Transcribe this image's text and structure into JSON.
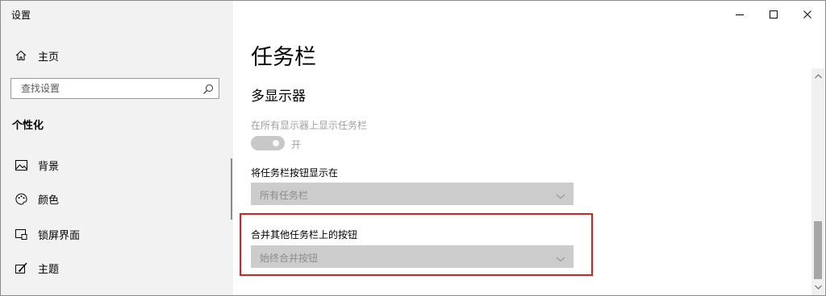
{
  "window": {
    "title": "设置",
    "minimize_glyph": "–",
    "maximize_glyph": "☐",
    "close_glyph": "✕"
  },
  "sidebar": {
    "home_label": "主页",
    "search_placeholder": "查找设置",
    "section_heading": "个性化",
    "items": [
      {
        "label": "背景",
        "icon": "image-icon"
      },
      {
        "label": "颜色",
        "icon": "palette-icon"
      },
      {
        "label": "锁屏界面",
        "icon": "lock-screen-icon"
      },
      {
        "label": "主题",
        "icon": "theme-brush-icon"
      }
    ]
  },
  "main": {
    "page_title": "任务栏",
    "group_title": "多显示器",
    "show_taskbar_label": "在所有显示器上显示任务栏",
    "toggle_state": "开",
    "buttons_on_label": "将任务栏按钮显示在",
    "buttons_on_value": "所有任务栏",
    "combine_label": "合并其他任务栏上的按钮",
    "combine_value": "始终合并按钮"
  },
  "colors": {
    "highlight_border": "#e21b1b",
    "sidebar_bg": "#f2f2f2",
    "dropdown_bg": "#cccccc",
    "disabled_text": "#a0a0a0"
  }
}
